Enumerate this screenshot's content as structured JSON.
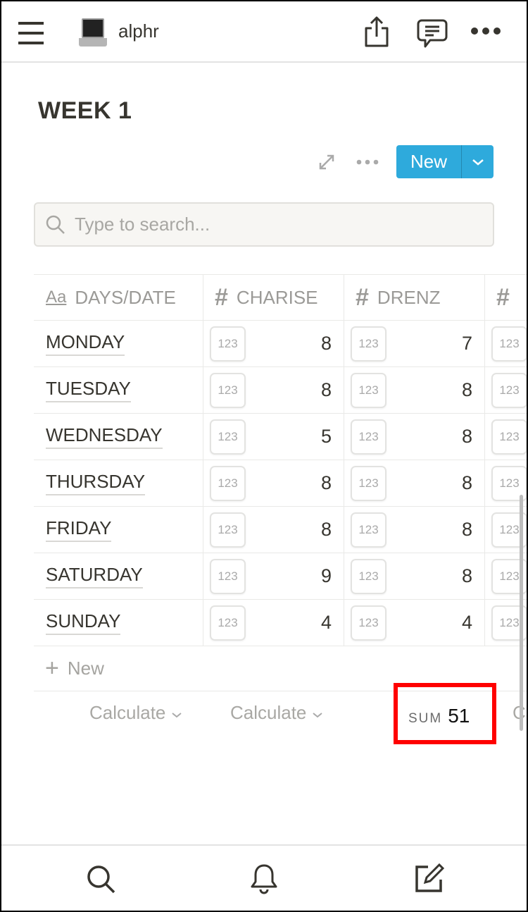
{
  "header": {
    "workspace": "alphr",
    "icons": [
      "menu-icon",
      "laptop-icon",
      "share-icon",
      "comment-icon",
      "more-icon"
    ]
  },
  "page": {
    "title": "WEEK 1"
  },
  "toolbar": {
    "new_label": "New"
  },
  "search": {
    "placeholder": "Type to search..."
  },
  "table": {
    "columns": [
      {
        "label": "DAYS/DATE",
        "icon": "text-property-icon"
      },
      {
        "label": "CHARISE",
        "icon": "hash-icon"
      },
      {
        "label": "DRENZ",
        "icon": "hash-icon"
      },
      {
        "label": "",
        "icon": "hash-icon"
      }
    ],
    "badge": "123",
    "rows": [
      {
        "day": "MONDAY",
        "charise": "8",
        "drenz": "7"
      },
      {
        "day": "TUESDAY",
        "charise": "8",
        "drenz": "8"
      },
      {
        "day": "WEDNESDAY",
        "charise": "5",
        "drenz": "8"
      },
      {
        "day": "THURSDAY",
        "charise": "8",
        "drenz": "8"
      },
      {
        "day": "FRIDAY",
        "charise": "8",
        "drenz": "8"
      },
      {
        "day": "SATURDAY",
        "charise": "9",
        "drenz": "8"
      },
      {
        "day": "SUNDAY",
        "charise": "4",
        "drenz": "4"
      }
    ],
    "new_row": "New",
    "footer": {
      "calc1": "Calculate",
      "calc2": "Calculate",
      "sum_label": "SUM",
      "sum_value": "51",
      "calc4": "Ca"
    }
  },
  "highlight_color": "#ff0000",
  "accent": "#2eaadc"
}
